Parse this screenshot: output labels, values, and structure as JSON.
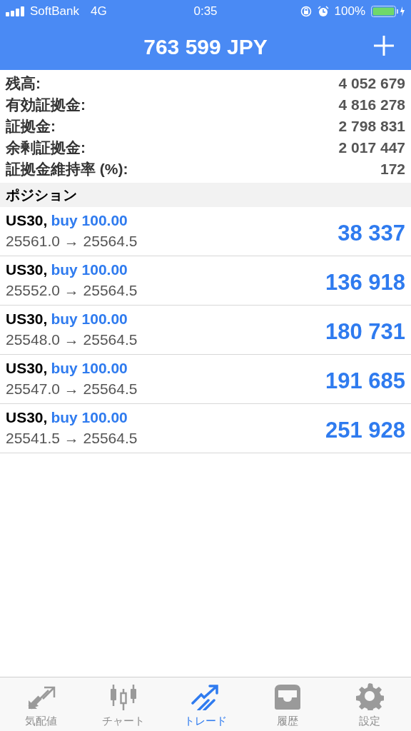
{
  "status_bar": {
    "carrier": "SoftBank",
    "network": "4G",
    "time": "0:35",
    "battery": "100%"
  },
  "header": {
    "title": "763 599 JPY"
  },
  "summary": [
    {
      "label": "残高:",
      "value": "4 052 679"
    },
    {
      "label": "有効証拠金:",
      "value": "4 816 278"
    },
    {
      "label": "証拠金:",
      "value": "2 798 831"
    },
    {
      "label": "余剰証拠金:",
      "value": "2 017 447"
    },
    {
      "label": "証拠金維持率 (%):",
      "value": "172"
    }
  ],
  "section_title": "ポジション",
  "positions": [
    {
      "symbol": "US30,",
      "order": "buy 100.00",
      "prices": "25561.0 → 25564.5",
      "profit": "38 337"
    },
    {
      "symbol": "US30,",
      "order": "buy 100.00",
      "prices": "25552.0 → 25564.5",
      "profit": "136 918"
    },
    {
      "symbol": "US30,",
      "order": "buy 100.00",
      "prices": "25548.0 → 25564.5",
      "profit": "180 731"
    },
    {
      "symbol": "US30,",
      "order": "buy 100.00",
      "prices": "25547.0 → 25564.5",
      "profit": "191 685"
    },
    {
      "symbol": "US30,",
      "order": "buy 100.00",
      "prices": "25541.5 → 25564.5",
      "profit": "251 928"
    }
  ],
  "tabs": [
    {
      "kind": "quotes",
      "label": "気配値",
      "selected": false
    },
    {
      "kind": "chart",
      "label": "チャート",
      "selected": false
    },
    {
      "kind": "trade",
      "label": "トレード",
      "selected": true
    },
    {
      "kind": "history",
      "label": "履歴",
      "selected": false
    },
    {
      "kind": "settings",
      "label": "設定",
      "selected": false
    }
  ]
}
